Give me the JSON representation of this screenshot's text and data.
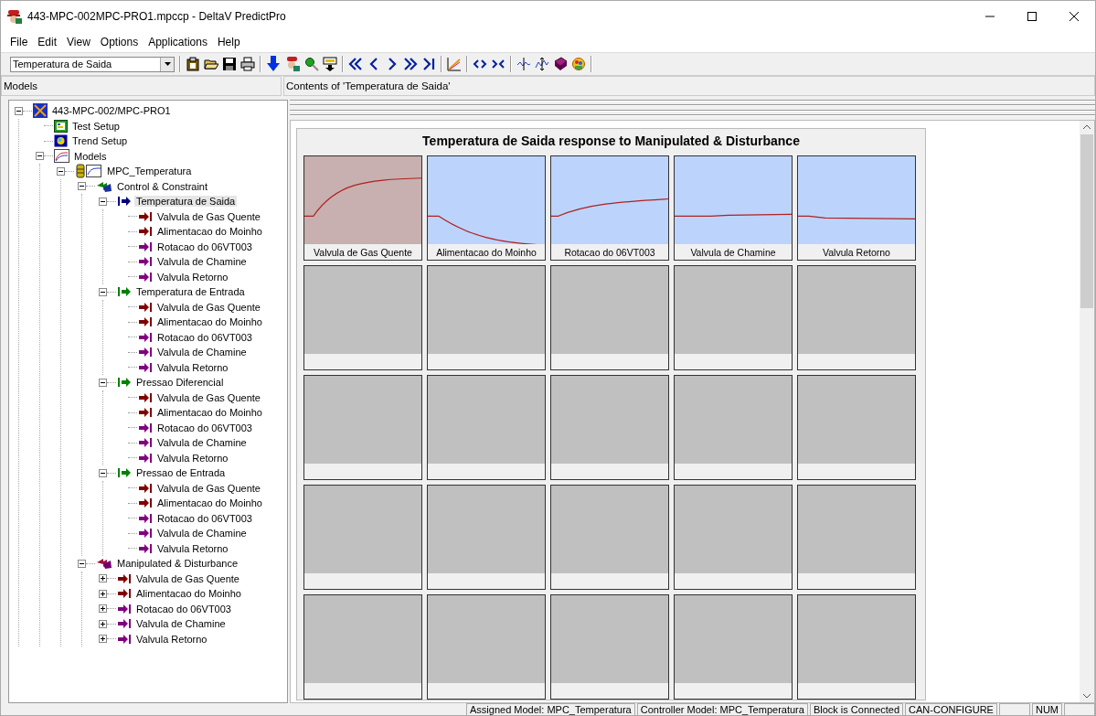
{
  "window": {
    "title": "443-MPC-002MPC-PRO1.mpccp - DeltaV PredictPro"
  },
  "menu": [
    "File",
    "Edit",
    "View",
    "Options",
    "Applications",
    "Help"
  ],
  "toolbar": {
    "selector": "Temperatura de Saida"
  },
  "models_header": "Models",
  "contents_header": "Contents of 'Temperatura de Saida'",
  "tree": [
    {
      "label": "443-MPC-002/MPC-PRO1",
      "kind": "root",
      "expanded": true,
      "selected": false,
      "children": [
        {
          "label": "Test Setup",
          "kind": "test",
          "selected": false
        },
        {
          "label": "Trend Setup",
          "kind": "trend",
          "selected": false
        },
        {
          "label": "Models",
          "kind": "models",
          "expanded": true,
          "selected": false,
          "children": [
            {
              "label": "MPC_Temperatura",
              "kind": "model",
              "expanded": true,
              "selected": false,
              "children": [
                {
                  "label": "Control & Constraint",
                  "kind": "cv_group",
                  "expanded": true,
                  "selected": false,
                  "children": [
                    {
                      "label": "Temperatura de Saida",
                      "kind": "output",
                      "color": "#000080",
                      "expanded": true,
                      "selected": true,
                      "children": [
                        {
                          "label": "Valvula de Gas Quente",
                          "kind": "input",
                          "color": "#800000",
                          "selected": false
                        },
                        {
                          "label": "Alimentacao do Moinho",
                          "kind": "input",
                          "color": "#800000",
                          "selected": false
                        },
                        {
                          "label": "Rotacao do 06VT003",
                          "kind": "input",
                          "color": "#800080",
                          "selected": false
                        },
                        {
                          "label": "Valvula de Chamine",
                          "kind": "input",
                          "color": "#800080",
                          "selected": false
                        },
                        {
                          "label": "Valvula Retorno",
                          "kind": "input",
                          "color": "#800080",
                          "selected": false
                        }
                      ]
                    },
                    {
                      "label": "Temperatura de Entrada",
                      "kind": "output",
                      "color": "#008000",
                      "expanded": true,
                      "selected": false,
                      "children": [
                        {
                          "label": "Valvula de Gas Quente",
                          "kind": "input",
                          "color": "#800000",
                          "selected": false
                        },
                        {
                          "label": "Alimentacao do Moinho",
                          "kind": "input",
                          "color": "#800000",
                          "selected": false
                        },
                        {
                          "label": "Rotacao do 06VT003",
                          "kind": "input",
                          "color": "#800080",
                          "selected": false
                        },
                        {
                          "label": "Valvula de Chamine",
                          "kind": "input",
                          "color": "#800080",
                          "selected": false
                        },
                        {
                          "label": "Valvula Retorno",
                          "kind": "input",
                          "color": "#800080",
                          "selected": false
                        }
                      ]
                    },
                    {
                      "label": "Pressao Diferencial",
                      "kind": "output",
                      "color": "#008000",
                      "expanded": true,
                      "selected": false,
                      "children": [
                        {
                          "label": "Valvula de Gas Quente",
                          "kind": "input",
                          "color": "#800000",
                          "selected": false
                        },
                        {
                          "label": "Alimentacao do Moinho",
                          "kind": "input",
                          "color": "#800000",
                          "selected": false
                        },
                        {
                          "label": "Rotacao do 06VT003",
                          "kind": "input",
                          "color": "#800080",
                          "selected": false
                        },
                        {
                          "label": "Valvula de Chamine",
                          "kind": "input",
                          "color": "#800080",
                          "selected": false
                        },
                        {
                          "label": "Valvula Retorno",
                          "kind": "input",
                          "color": "#800080",
                          "selected": false
                        }
                      ]
                    },
                    {
                      "label": "Pressao de Entrada",
                      "kind": "output",
                      "color": "#008000",
                      "expanded": true,
                      "selected": false,
                      "children": [
                        {
                          "label": "Valvula de Gas Quente",
                          "kind": "input",
                          "color": "#800000",
                          "selected": false
                        },
                        {
                          "label": "Alimentacao do Moinho",
                          "kind": "input",
                          "color": "#800000",
                          "selected": false
                        },
                        {
                          "label": "Rotacao do 06VT003",
                          "kind": "input",
                          "color": "#800080",
                          "selected": false
                        },
                        {
                          "label": "Valvula de Chamine",
                          "kind": "input",
                          "color": "#800080",
                          "selected": false
                        },
                        {
                          "label": "Valvula Retorno",
                          "kind": "input",
                          "color": "#800080",
                          "selected": false
                        }
                      ]
                    }
                  ]
                },
                {
                  "label": "Manipulated & Disturbance",
                  "kind": "md_group",
                  "expanded": true,
                  "selected": false,
                  "children": [
                    {
                      "label": "Valvula de Gas Quente",
                      "kind": "input",
                      "color": "#800000",
                      "expanded": false,
                      "selected": false
                    },
                    {
                      "label": "Alimentacao do Moinho",
                      "kind": "input",
                      "color": "#800000",
                      "expanded": false,
                      "selected": false
                    },
                    {
                      "label": "Rotacao do 06VT003",
                      "kind": "input",
                      "color": "#800080",
                      "expanded": false,
                      "selected": false
                    },
                    {
                      "label": "Valvula de Chamine",
                      "kind": "input",
                      "color": "#800080",
                      "expanded": false,
                      "selected": false
                    },
                    {
                      "label": "Valvula Retorno",
                      "kind": "input",
                      "color": "#800080",
                      "expanded": false,
                      "selected": false
                    }
                  ]
                }
              ]
            }
          ]
        }
      ]
    }
  ],
  "response_panel": {
    "title": "Temperatura de Saida  response to Manipulated & Disturbance",
    "tiles": [
      {
        "kind": "rise_fast",
        "label": "Valvula de Gas Quente",
        "selected": true
      },
      {
        "kind": "fall",
        "label": "Alimentacao do Moinho",
        "selected": false
      },
      {
        "kind": "rise_slow",
        "label": "Rotacao do 06VT003",
        "selected": false
      },
      {
        "kind": "flat_up",
        "label": "Valvula de Chamine",
        "selected": false
      },
      {
        "kind": "flat_down",
        "label": "Valvula Retorno",
        "selected": false
      },
      {
        "kind": "empty"
      },
      {
        "kind": "empty"
      },
      {
        "kind": "empty"
      },
      {
        "kind": "empty"
      },
      {
        "kind": "empty"
      },
      {
        "kind": "empty"
      },
      {
        "kind": "empty"
      },
      {
        "kind": "empty"
      },
      {
        "kind": "empty"
      },
      {
        "kind": "empty"
      },
      {
        "kind": "empty"
      },
      {
        "kind": "empty"
      },
      {
        "kind": "empty"
      },
      {
        "kind": "empty"
      },
      {
        "kind": "empty"
      },
      {
        "kind": "empty"
      },
      {
        "kind": "empty"
      },
      {
        "kind": "empty"
      },
      {
        "kind": "empty"
      },
      {
        "kind": "empty"
      }
    ]
  },
  "status_bar": [
    "Assigned Model: MPC_Temperatura",
    "Controller Model: MPC_Temperatura",
    "Block is Connected",
    "CAN-CONFIGURE",
    "NUM"
  ]
}
